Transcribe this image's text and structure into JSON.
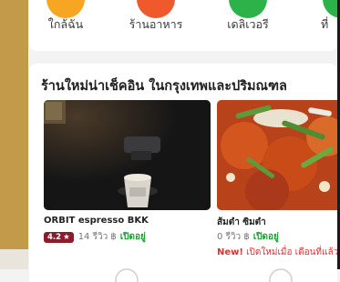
{
  "categories": [
    {
      "label": "ใกล้ฉัน",
      "icon": "nearby-icon",
      "color": "#f6a623"
    },
    {
      "label": "ร้านอาหาร",
      "icon": "restaurant-icon",
      "color": "#f0592b"
    },
    {
      "label": "เดลิเวอรี",
      "icon": "delivery-icon",
      "color": "#2bb34a"
    },
    {
      "label": "ที่",
      "icon": "more-icon",
      "color": "#2bb34a"
    }
  ],
  "section": {
    "title": "ร้านใหม่น่าเช็คอิน ในกรุงเทพและปริมณฑล"
  },
  "cards": [
    {
      "name": "ORBIT espresso BKK",
      "rating": "4.2",
      "reviews": "14 รีวิว",
      "price": "฿",
      "status": "เปิดอยู่"
    },
    {
      "name": "ส้มตำ ซิมตำ",
      "reviews": "0 รีวิว",
      "price": "฿",
      "status": "เปิดอยู่",
      "new_label": "New!",
      "new_text": "เปิดใหม่เมื่อ เดือนที่แล้ว"
    }
  ],
  "colors": {
    "accent_rating": "#8b1c2c",
    "open": "#1e9e35",
    "new": "#e22f2f"
  }
}
